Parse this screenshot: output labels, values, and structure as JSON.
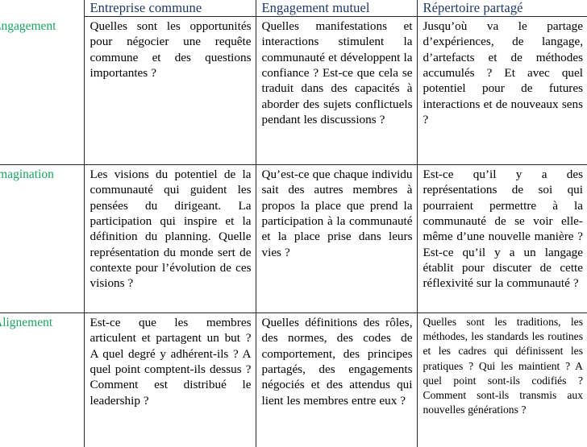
{
  "document": {
    "type": "table",
    "language": "fr",
    "colors": {
      "header_text": "#1f3864",
      "row_label_text": "#1aa463",
      "body_text": "#000000",
      "border": "#2a2a2a",
      "background": "#ffffff"
    }
  },
  "table": {
    "corner_label": "",
    "column_headers": [
      "Entreprise commune",
      "Engagement mutuel",
      "Répertoire partagé"
    ],
    "rows": [
      {
        "label": "Engagement",
        "cells": [
          "Quelles sont les opportunités pour négocier une requête commune et des questions importantes ?",
          "Quelles manifestations et interactions stimulent la communauté et développent la confiance ? Est-ce que cela se traduit dans des capacités à aborder des sujets conflictuels pendant les discussions ?",
          "Jusqu’où va le partage d’expériences, de langage, d’artefacts et de méthodes accumulés ? Et avec quel potentiel pour de futures interactions et de nouveaux sens ?"
        ]
      },
      {
        "label": "Imagination",
        "cells": [
          "Les visions du potentiel de la communauté qui guident les pensées du dirigeant. La participation qui inspire et la définition du planning. Quelle représentation du monde sert de contexte pour l’évolution de ces visions ?",
          "Qu’est-ce que chaque individu sait des autres membres à propos la place que prend la participation à la communauté et la place prise dans leurs vies ?",
          "Est-ce qu’il y a des représentations de soi qui pourraient permettre à la communauté de se voir elle-même d’une nouvelle manière ? Est-ce qu’il y a un langage établit pour discuter de cette réflexivité sur la communauté ?"
        ]
      },
      {
        "label": "Alignement",
        "cells": [
          "Est-ce que les membres articulent et partagent un but ? A quel degré y adhérent-ils ? A quel point comptent-ils dessus ? Comment est distribué le leadership ?",
          "Quelles définitions des rôles, des normes, des codes de comportement, des principes partagés, des engagements négociés et des attendus qui lient les membres entre eux ?",
          "Quelles sont les traditions, les méthodes, les standards les routines et les cadres qui définissent les pratiques ? Qui les maintient ? A quel point sont-ils codifiés ? Comment sont-ils transmis aux nouvelles générations ?"
        ]
      }
    ]
  }
}
